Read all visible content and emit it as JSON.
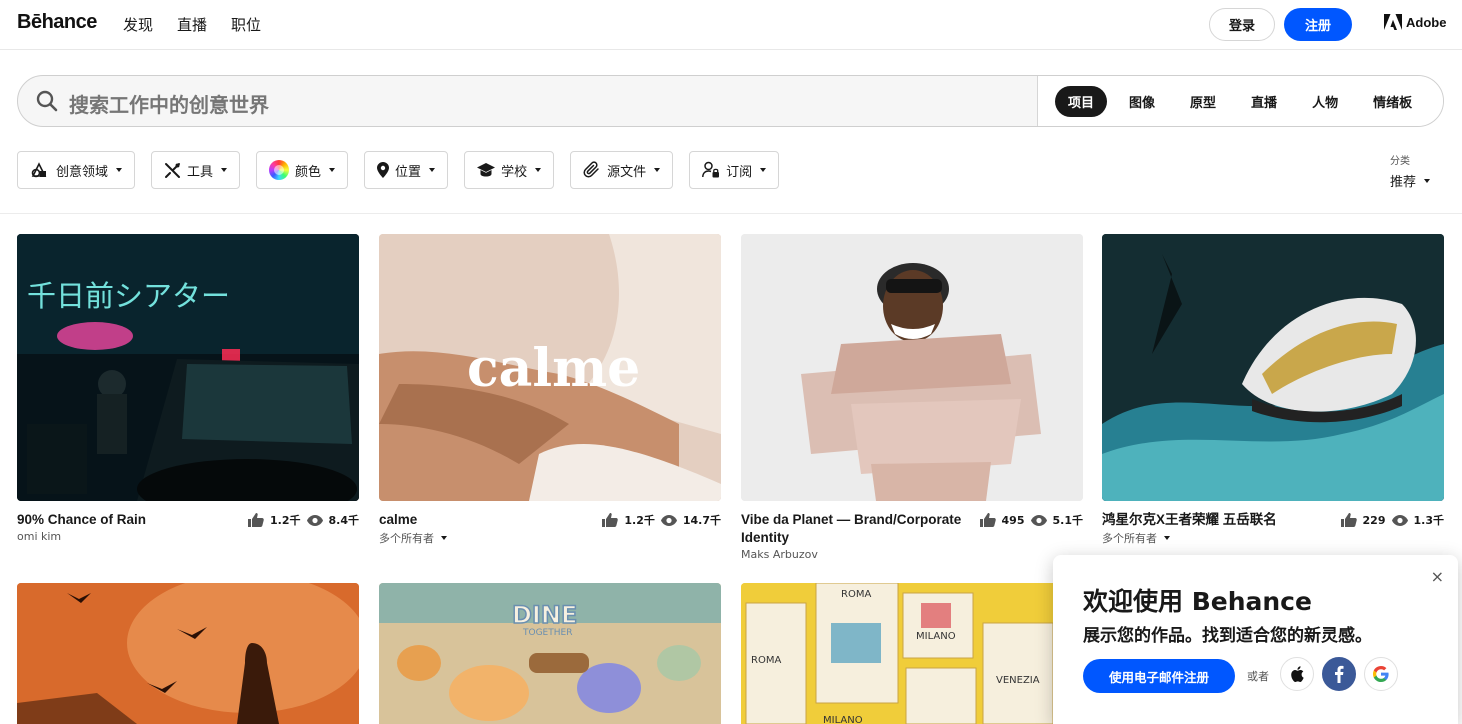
{
  "nav": {
    "logo": "Bēhance",
    "links": [
      "发现",
      "直播",
      "职位"
    ],
    "login": "登录",
    "signup": "注册",
    "adobe": "Adobe"
  },
  "search": {
    "placeholder": "搜索工作中的创意世界",
    "tabs": [
      "项目",
      "图像",
      "原型",
      "直播",
      "人物",
      "情绪板"
    ],
    "active_tab": "项目"
  },
  "filters": [
    {
      "label": "创意领域",
      "icon": "creative-fields-icon"
    },
    {
      "label": "工具",
      "icon": "tools-icon"
    },
    {
      "label": "颜色",
      "icon": "color-wheel-icon"
    },
    {
      "label": "位置",
      "icon": "location-pin-icon"
    },
    {
      "label": "学校",
      "icon": "graduation-cap-icon"
    },
    {
      "label": "源文件",
      "icon": "paperclip-icon"
    },
    {
      "label": "订阅",
      "icon": "subscription-icon"
    }
  ],
  "sort": {
    "label": "分类",
    "value": "推荐"
  },
  "projects": [
    {
      "title": "90% Chance of Rain",
      "owner": "omi kim",
      "likes": "1.2千",
      "views": "8.4千",
      "multi": false
    },
    {
      "title": "calme",
      "owner": "多个所有者",
      "likes": "1.2千",
      "views": "14.7千",
      "multi": true
    },
    {
      "title": "Vibe da Planet — Brand/Corporate Identity",
      "owner": "Maks Arbuzov",
      "likes": "495",
      "views": "5.1千",
      "multi": false
    },
    {
      "title": "鸿星尔克X王者荣耀 五岳联名",
      "owner": "多个所有者",
      "likes": "229",
      "views": "1.3千",
      "multi": true
    }
  ],
  "art_text": {
    "neon_sign": "千日前シアター",
    "calme_logo": "calme",
    "dine_title": "DINE",
    "dine_sub": "TOGETHER",
    "poster_roma": "ROMA",
    "poster_milano": "MILANO",
    "poster_venezia": "VENEZIA"
  },
  "popup": {
    "title": "欢迎使用 Behance",
    "subtitle": "展示您的作品。找到适合您的新灵感。",
    "email_button": "使用电子邮件注册",
    "or": "或者",
    "close": "×"
  },
  "colors": {
    "accent": "#0057ff",
    "text": "#191919"
  }
}
